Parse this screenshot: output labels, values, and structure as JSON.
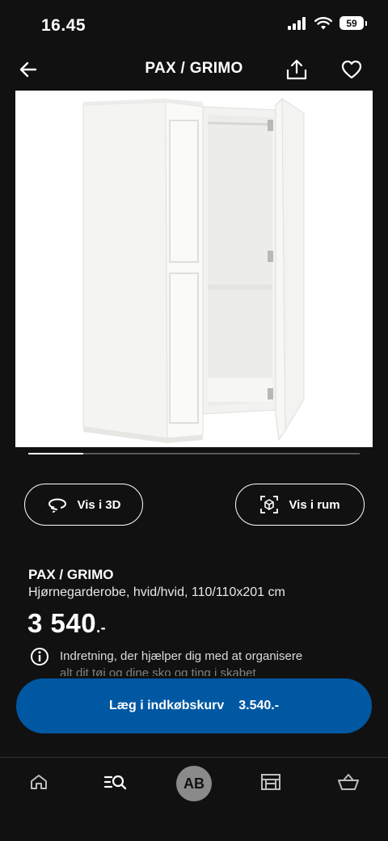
{
  "status_bar": {
    "time": "16.45",
    "battery": "59"
  },
  "nav": {
    "title": "PAX / GRIMO"
  },
  "carousel": {
    "progress": 0.165
  },
  "actions": {
    "view_3d": "Vis i 3D",
    "view_room": "Vis i rum"
  },
  "product": {
    "name": "PAX / GRIMO",
    "description": "Hjørnegarderobe, hvid/hvid, 110/110x201 cm",
    "price": "3 540",
    "price_suffix": ".-",
    "info_text": "Indretning, der hjælper dig med at organisere",
    "info_text_cont": "alt dit tøj og dine sko og ting i skabet"
  },
  "cart_button": {
    "label": "Læg i indkøbskurv",
    "price": "3.540.-"
  },
  "tab_bar": {
    "avatar_initials": "AB"
  },
  "colors": {
    "background": "#111111",
    "accent": "#0058a3",
    "text": "#ffffff"
  }
}
